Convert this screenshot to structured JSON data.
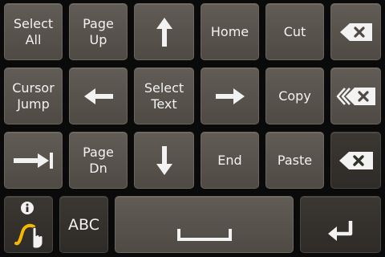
{
  "keys": {
    "select_all": [
      "Select",
      "All"
    ],
    "page_up": [
      "Page",
      "Up"
    ],
    "home": "Home",
    "cut": "Cut",
    "cursor_jump": [
      "Cursor",
      "Jump"
    ],
    "select_text": [
      "Select",
      "Text"
    ],
    "copy": "Copy",
    "page_dn": [
      "Page",
      "Dn"
    ],
    "end": "End",
    "paste": "Paste",
    "abc": "ABC"
  },
  "icons": {
    "up": "arrow-up-icon",
    "left": "arrow-left-icon",
    "right": "arrow-right-icon",
    "down": "arrow-down-icon",
    "tab": "tab-icon",
    "backspace": "backspace-icon",
    "delete_word": "delete-word-icon",
    "delete_forward": "delete-forward-icon",
    "info": "info-icon",
    "gesture": "swipe-gesture-icon",
    "space": "space-bar-icon",
    "enter": "enter-icon"
  },
  "colors": {
    "key_face": "#58534c",
    "key_dark": "#33302c",
    "label": "#f2f2f2",
    "gesture_accent": "#f5b800"
  }
}
